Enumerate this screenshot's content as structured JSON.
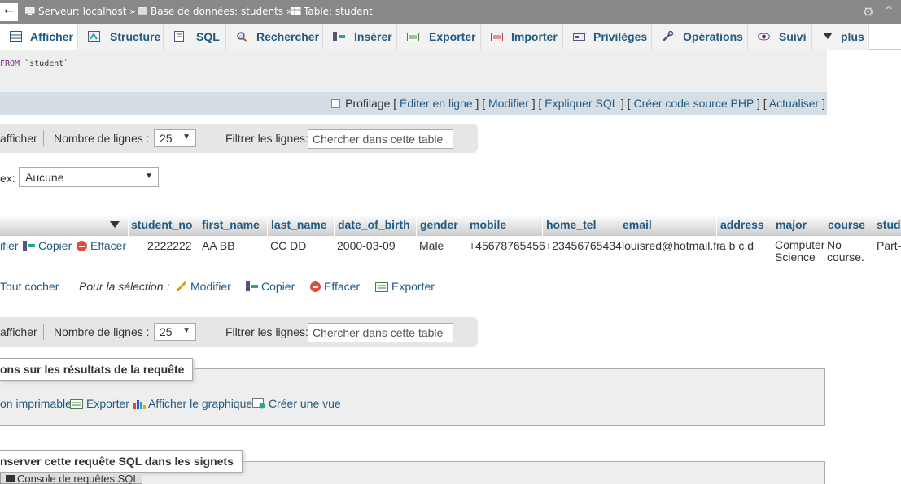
{
  "breadcrumb": {
    "server": "Serveur: localhost »",
    "database": "Base de données: students »",
    "table": "Table: student"
  },
  "tabs": [
    {
      "label": "Afficher",
      "icon": "browse-icon"
    },
    {
      "label": "Structure",
      "icon": "structure-icon"
    },
    {
      "label": "SQL",
      "icon": "sql-icon"
    },
    {
      "label": "Rechercher",
      "icon": "search-icon"
    },
    {
      "label": "Insérer",
      "icon": "insert-icon"
    },
    {
      "label": "Exporter",
      "icon": "export-icon"
    },
    {
      "label": "Importer",
      "icon": "import-icon"
    },
    {
      "label": "Privilèges",
      "icon": "privileges-icon"
    },
    {
      "label": "Opérations",
      "icon": "wrench-icon"
    },
    {
      "label": "Suivi",
      "icon": "eye-icon"
    },
    {
      "label": "plus",
      "icon": "chevron-down-icon"
    }
  ],
  "sql": {
    "keyword": "FROM",
    "rest": " `student`"
  },
  "profiling": {
    "label": "Profilage",
    "links": [
      "Éditer en ligne",
      "Modifier",
      "Expliquer SQL",
      "Créer code source PHP",
      "Actualiser"
    ]
  },
  "nav": {
    "show_label": "afficher",
    "rows_label": "Nombre de lignes :",
    "rows_value": "25",
    "filter_label": "Filtrer les lignes:",
    "filter_placeholder": "Chercher dans cette table"
  },
  "index": {
    "label": "ex:",
    "value": "Aucune"
  },
  "table": {
    "headers": [
      "student_no",
      "first_name",
      "last_name",
      "date_of_birth",
      "gender",
      "mobile",
      "home_tel",
      "email",
      "address",
      "major",
      "course",
      "stud"
    ],
    "row_actions": {
      "edit": "ifier",
      "copy": "Copier",
      "delete": "Effacer"
    },
    "rows": [
      [
        "2222222",
        "AA BB",
        "CC DD",
        "2000-03-09",
        "Male",
        "+45678765456",
        "+23456765434",
        "louisred@hotmail.fr",
        "a b c d",
        "Computer Science",
        "No course.",
        "Part-"
      ]
    ]
  },
  "selection": {
    "check_all": "Tout cocher",
    "for_selection": "Pour la sélection :",
    "edit": "Modifier",
    "copy": "Copier",
    "delete": "Effacer",
    "export": "Exporter"
  },
  "query_ops": {
    "legend": "ons sur les résultats de la requête",
    "print": "on imprimable",
    "export": "Exporter",
    "chart": "Afficher le graphique",
    "create_view": "Créer une vue"
  },
  "bookmark": {
    "legend": "nserver cette requête SQL dans les signets"
  },
  "console": {
    "label": "Console de requêtes SQL"
  }
}
